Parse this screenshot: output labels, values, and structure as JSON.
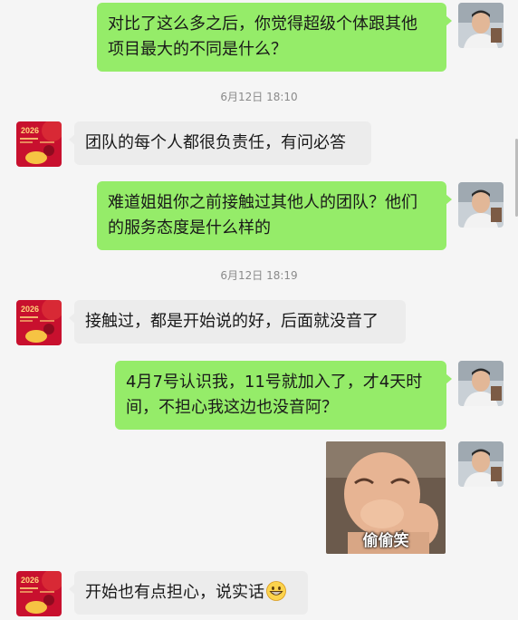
{
  "messages": [
    {
      "sender": "me",
      "text": "对比了这么多之后，你觉得超级个体跟其他\n项目最大的不同是什么？"
    },
    {
      "timestamp": "6月12日 18:10"
    },
    {
      "sender": "other",
      "text": "团队的每个人都很负责任，有问必答"
    },
    {
      "sender": "me",
      "text": "难道姐姐你之前接触过其他人的团队？他们\n的服务态度是什么样的"
    },
    {
      "timestamp": "6月12日 18:19"
    },
    {
      "sender": "other",
      "text": "接触过，都是开始说的好，后面就没音了"
    },
    {
      "sender": "me",
      "text": "4月7号认识我，11号就加入了，才4天时\n间，不担心我这边也没音阿？"
    },
    {
      "sender": "me",
      "sticker_caption": "偷偷笑"
    },
    {
      "sender": "other",
      "text": "开始也有点担心，说实话",
      "emoji": "grinning-face"
    }
  ],
  "avatar_other": {
    "badge_text": "2026",
    "bg_color": "#c8102e"
  },
  "colors": {
    "sent_bubble": "#95ec69",
    "received_bubble": "#ececec",
    "background": "#f5f5f5",
    "timestamp": "#8a8a8a"
  }
}
